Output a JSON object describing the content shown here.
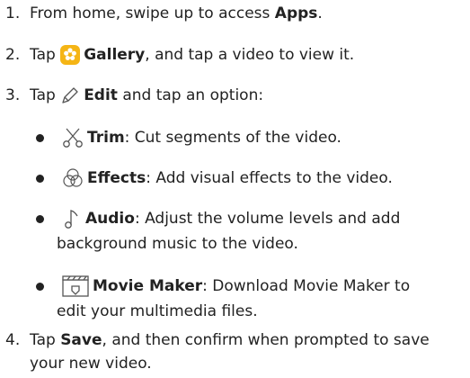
{
  "steps": [
    {
      "num": "1.",
      "pre": "From home, swipe up to access ",
      "bold": "Apps",
      "post": "."
    },
    {
      "num": "2.",
      "pre": "Tap ",
      "bold": "Gallery",
      "post": ", and tap a video to view it."
    },
    {
      "num": "3.",
      "pre": "Tap ",
      "bold": "Edit",
      "post": " and tap an option:"
    },
    {
      "num": "4.",
      "pre": "Tap ",
      "bold": "Save",
      "post": ", and then confirm when prompted to save",
      "line2": "your new video."
    }
  ],
  "options": [
    {
      "icon": "scissors-icon",
      "bold": "Trim",
      "text": ": Cut segments of the video."
    },
    {
      "icon": "effects-icon",
      "bold": "Effects",
      "text": ": Add visual effects to the video."
    },
    {
      "icon": "music-note-icon",
      "bold": "Audio",
      "text": ": Adjust the volume levels and add",
      "line2": "background music to the video."
    },
    {
      "icon": "movie-maker-icon",
      "bold": "Movie Maker",
      "text": ": Download Movie Maker to",
      "line2": "edit your multimedia files."
    }
  ],
  "colors": {
    "gallery_icon": "#f5b515",
    "text": "#222222"
  }
}
